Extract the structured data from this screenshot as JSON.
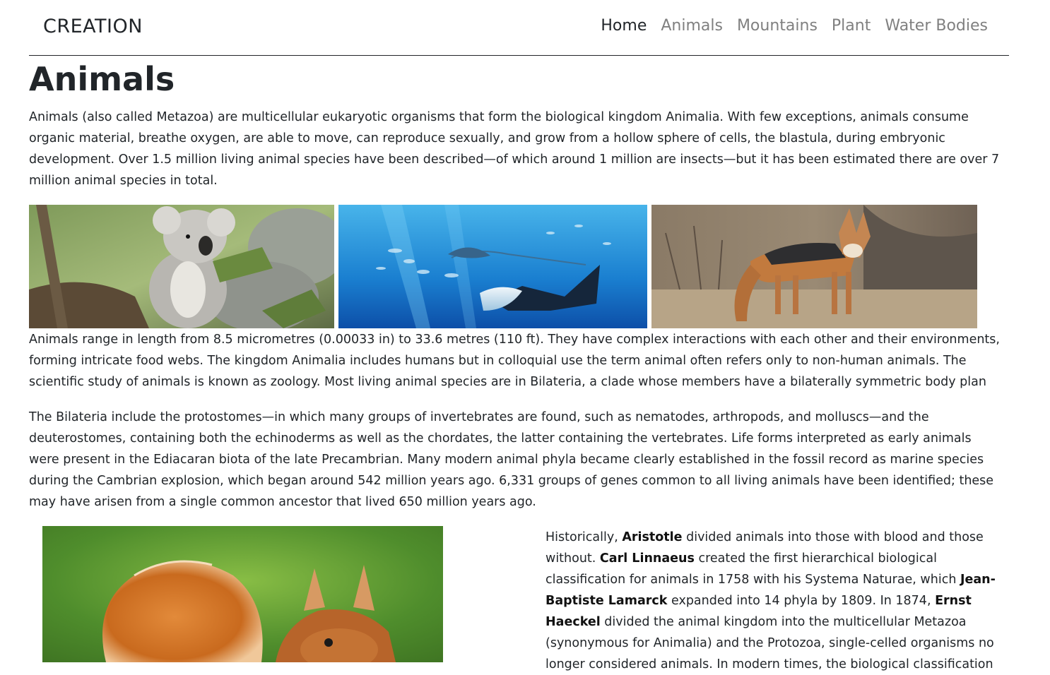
{
  "navbar": {
    "brand": "CREATION",
    "links": [
      "Home",
      "Animals",
      "Mountains",
      "Plant",
      "Water Bodies"
    ]
  },
  "page": {
    "title": "Animals",
    "intro": "Animals (also called Metazoa) are multicellular eukaryotic organisms that form the biological kingdom Animalia. With few exceptions, animals consume organic material, breathe oxygen, are able to move, can reproduce sexually, and grow from a hollow sphere of cells, the blastula, during embryonic development. Over 1.5 million living animal species have been described—of which around 1 million are insects—but it has been estimated there are over 7 million animal species in total.",
    "para2": "Animals range in length from 8.5 micrometres (0.00033 in) to 33.6 metres (110 ft). They have complex interactions with each other and their environments, forming intricate food webs. The kingdom Animalia includes humans but in colloquial use the term animal often refers only to non-human animals. The scientific study of animals is known as zoology. Most living animal species are in Bilateria, a clade whose members have a bilaterally symmetric body plan",
    "para3": "The Bilateria include the protostomes—in which many groups of invertebrates are found, such as nematodes, arthropods, and molluscs—and the deuterostomes, containing both the echinoderms as well as the chordates, the latter containing the vertebrates. Life forms interpreted as early animals were present in the Ediacaran biota of the late Precambrian. Many modern animal phyla became clearly established in the fossil record as marine species during the Cambrian explosion, which began around 542 million years ago. 6,331 groups of genes common to all living animals have been identified; these may have arisen from a single common ancestor that lived 650 million years ago.",
    "history": {
      "t1": "Historically, ",
      "aristotle": "Aristotle",
      "t2": " divided animals into those with blood and those without. ",
      "linnaeus": "Carl Linnaeus",
      "t3": " created the first hierarchical biological classification for animals in 1758 with his Systema Naturae, which ",
      "lamarck": "Jean-Baptiste Lamarck",
      "t4": " expanded into 14 phyla by 1809. In 1874, ",
      "haeckel": "Ernst Haeckel",
      "t5": " divided the animal kingdom into the multicellular Metazoa (synonymous for Animalia) and the Protozoa, single-celled organisms no longer considered animals. In modern times, the biological classification"
    }
  },
  "photos": [
    "koala",
    "manta-ray",
    "jackal",
    "squirrel"
  ]
}
